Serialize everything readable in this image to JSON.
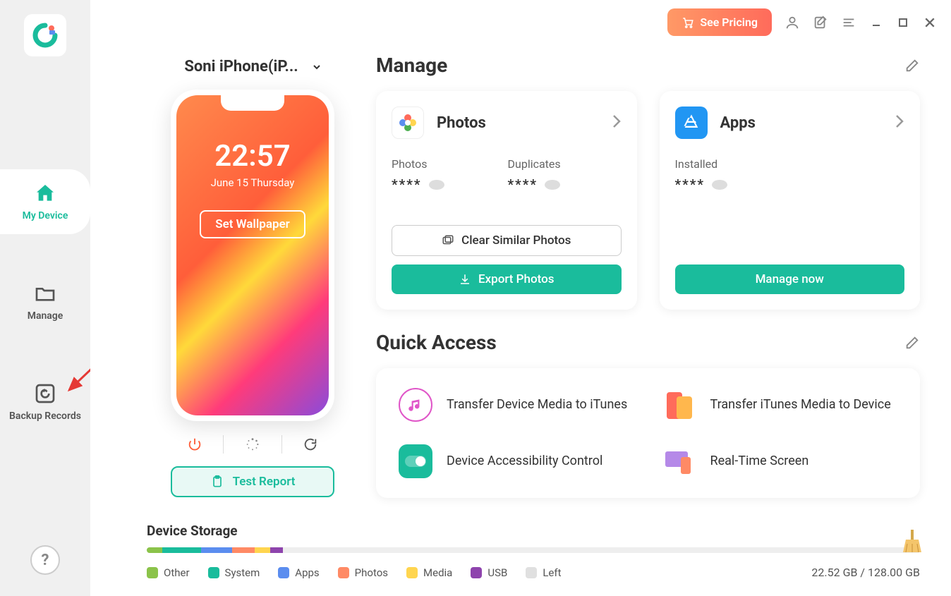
{
  "colors": {
    "accent": "#1abc9c",
    "pricing_start": "#ff9966",
    "pricing_end": "#ff6b5b"
  },
  "sidebar": {
    "items": [
      {
        "label": "My Device"
      },
      {
        "label": "Manage"
      },
      {
        "label": "Backup Records"
      }
    ]
  },
  "top": {
    "see_pricing": "See Pricing"
  },
  "device": {
    "name": "Soni iPhone(iP...",
    "time": "22:57",
    "date": "June 15 Thursday",
    "wallpaper_btn": "Set Wallpaper",
    "test_report": "Test Report"
  },
  "manage": {
    "title": "Manage",
    "photos": {
      "title": "Photos",
      "stat1_label": "Photos",
      "stat1_value": "****",
      "stat2_label": "Duplicates",
      "stat2_value": "****",
      "clear_btn": "Clear Similar Photos",
      "export_btn": "Export Photos"
    },
    "apps": {
      "title": "Apps",
      "stat1_label": "Installed",
      "stat1_value": "****",
      "manage_btn": "Manage now"
    }
  },
  "quick": {
    "title": "Quick Access",
    "items": [
      {
        "label": "Transfer Device Media to iTunes"
      },
      {
        "label": "Transfer iTunes Media to Device"
      },
      {
        "label": "Device Accessibility Control"
      },
      {
        "label": "Real-Time Screen"
      }
    ]
  },
  "storage": {
    "title": "Device Storage",
    "legend": [
      {
        "label": "Other",
        "color": "#8bc34a"
      },
      {
        "label": "System",
        "color": "#1abc9c"
      },
      {
        "label": "Apps",
        "color": "#5b8def"
      },
      {
        "label": "Photos",
        "color": "#ff8a65"
      },
      {
        "label": "Media",
        "color": "#ffd54f"
      },
      {
        "label": "USB",
        "color": "#8e44ad"
      },
      {
        "label": "Left",
        "color": "#e0e0e0"
      }
    ],
    "text": "22.52 GB / 128.00 GB"
  }
}
